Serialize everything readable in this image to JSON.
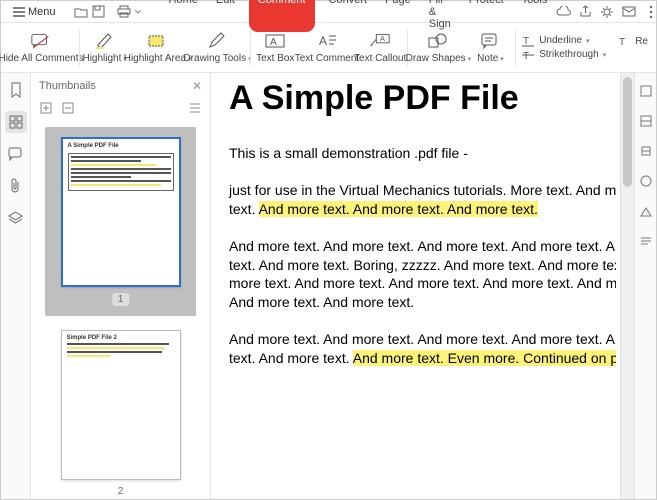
{
  "menubar": {
    "menu_label": "Menu",
    "tabs": [
      "Home",
      "Edit",
      "Comment",
      "Convert",
      "Page",
      "Fill & Sign",
      "Protect",
      "Tools"
    ],
    "active_tab": "Comment"
  },
  "toolbar": {
    "hide_all": "Hide All Comments",
    "highlight": "Highlight",
    "highlight_area": "Highlight Area",
    "drawing_tools": "Drawing Tools",
    "text_box": "Text Box",
    "text_comment": "Text Comment",
    "text_callout": "Text Callout",
    "draw_shapes": "Draw Shapes",
    "note": "Note",
    "underline": "Underline",
    "strikethrough": "Strikethrough",
    "replace": "Re"
  },
  "thumbs": {
    "title": "Thumbnails",
    "pages": [
      {
        "num": "1",
        "title": "A Simple PDF File"
      },
      {
        "num": "2",
        "title": "Simple PDF File 2"
      }
    ]
  },
  "doc": {
    "title": "A Simple PDF File",
    "p1": "This is a small demonstration .pdf file -",
    "p2a": "just for use in the Virtual Mechanics tutorials. More text. And mo",
    "p2b": "text. ",
    "p2hl": "And more text. And more text. And more text.",
    "p3a": "And more text. And more text. And more text. And more text. A",
    "p3b": "text. And more text. Boring, zzzzz. And more text. And more text.",
    "p3c": "more text. And more text. And more text. And more text. And m",
    "p3d": "And more text. And more text.",
    "p4a": "And more text. And more text. And more text. And more text. A",
    "p4b": "text. And more text. ",
    "p4hl": "And more text. Even more. Continued on p"
  }
}
